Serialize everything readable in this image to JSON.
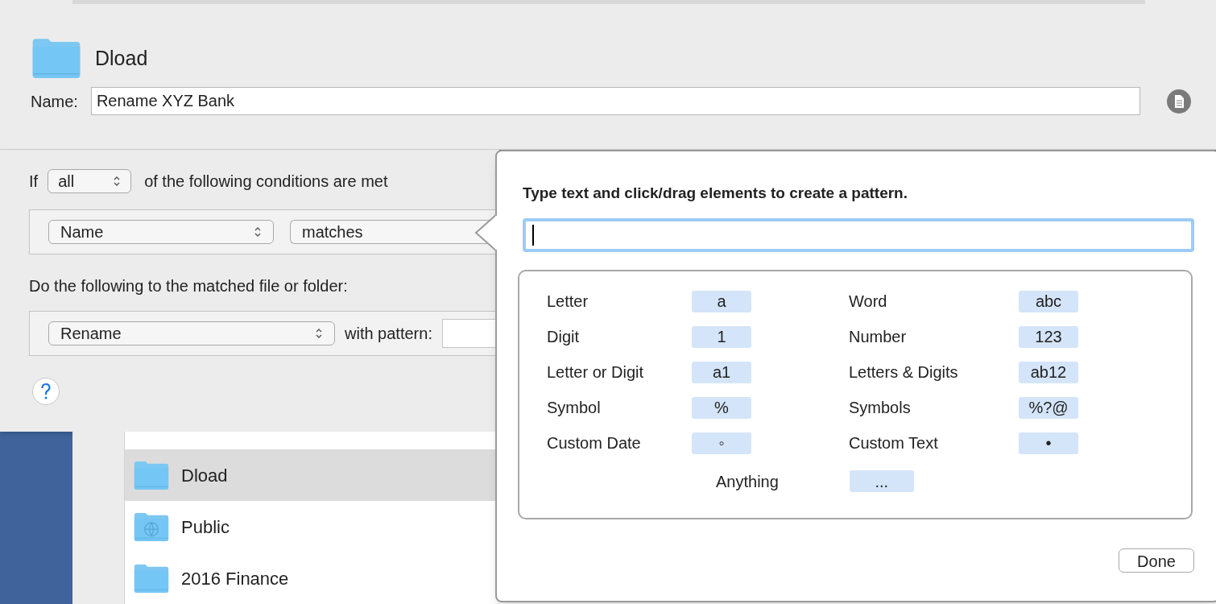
{
  "sheet": {
    "folder_name": "Dload",
    "name_label": "Name:",
    "name_value": "Rename XYZ Bank",
    "conditions": {
      "prefix": "If",
      "quantifier": "all",
      "suffix": "of the following conditions are met"
    },
    "condition_row": {
      "attribute": "Name",
      "operator": "matches"
    },
    "actions_label": "Do the following to the matched file or folder:",
    "action_row": {
      "action": "Rename",
      "pattern_label": "with pattern:"
    }
  },
  "popover": {
    "instruction": "Type text and click/drag elements to create a pattern.",
    "elements": [
      {
        "label": "Letter",
        "token": "a"
      },
      {
        "label": "Word",
        "token": "abc"
      },
      {
        "label": "Digit",
        "token": "1"
      },
      {
        "label": "Number",
        "token": "123"
      },
      {
        "label": "Letter or Digit",
        "token": "a1"
      },
      {
        "label": "Letters & Digits",
        "token": "ab12"
      },
      {
        "label": "Symbol",
        "token": "%"
      },
      {
        "label": "Symbols",
        "token": "%?@"
      },
      {
        "label": "Custom Date",
        "token": "◦"
      },
      {
        "label": "Custom Text",
        "token": "•"
      }
    ],
    "anything": {
      "label": "Anything",
      "token": "..."
    },
    "done": "Done"
  },
  "finder": {
    "rows": [
      {
        "name": "Dload",
        "kind": "folder",
        "selected": true
      },
      {
        "name": "Public",
        "kind": "public",
        "selected": false
      },
      {
        "name": "2016 Finance",
        "kind": "folder",
        "selected": false
      }
    ]
  }
}
